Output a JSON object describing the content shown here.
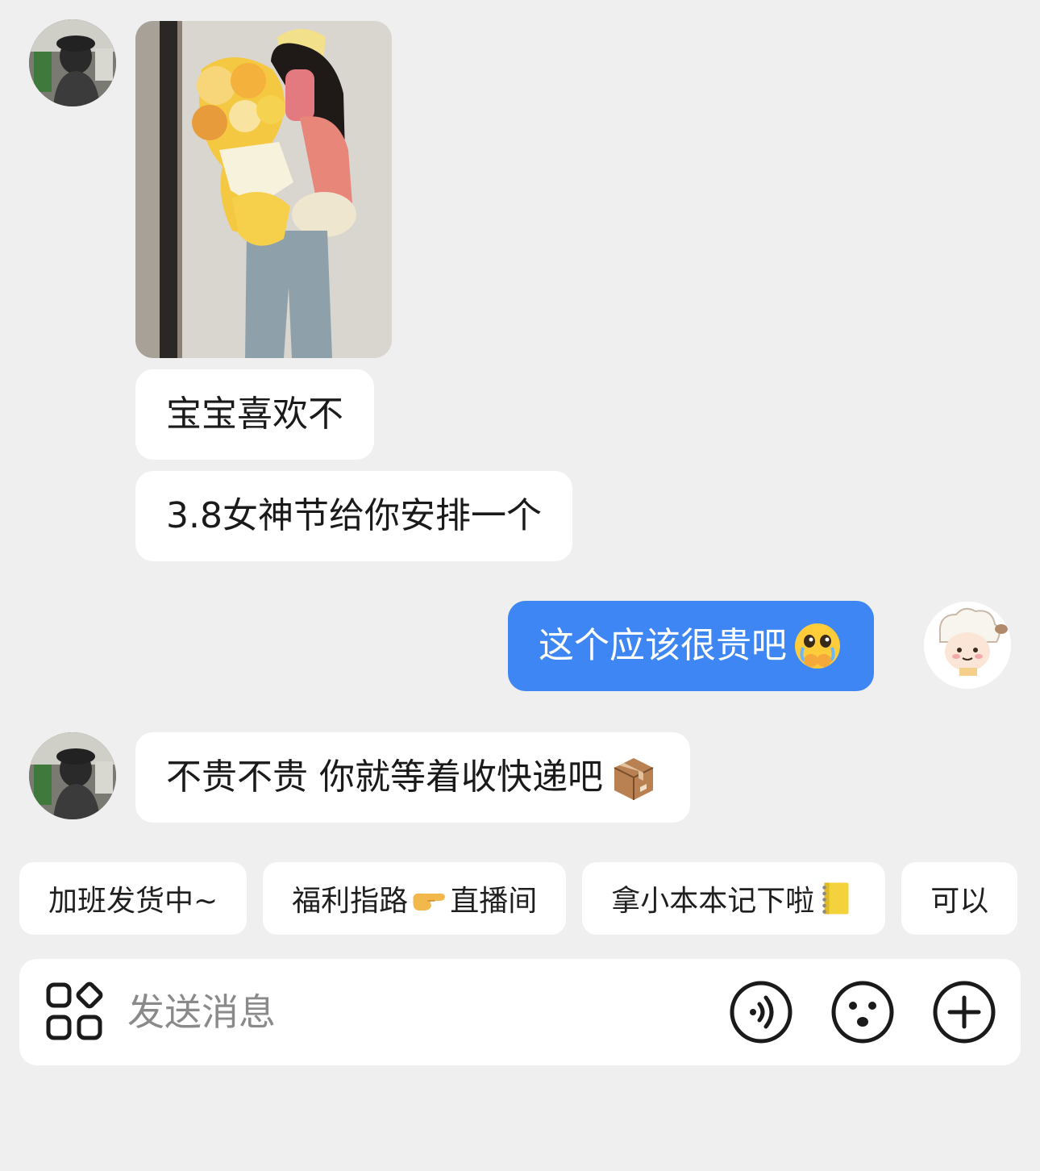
{
  "messages": [
    {
      "sender": "contact",
      "type": "image"
    },
    {
      "sender": "contact",
      "type": "text",
      "text": "宝宝喜欢不"
    },
    {
      "sender": "contact",
      "type": "text",
      "text": "3.8女神节给你安排一个"
    },
    {
      "sender": "me",
      "type": "text",
      "text": "这个应该很贵吧",
      "emoji": "crying-face-emoji"
    },
    {
      "sender": "contact",
      "type": "text",
      "text": "不贵不贵 你就等着收快递吧",
      "emoji": "package-emoji"
    }
  ],
  "quick_replies": [
    {
      "label": "加班发货中~"
    },
    {
      "label_before": "福利指路",
      "emoji": "pointing-right-emoji",
      "label_after": "直播间"
    },
    {
      "label": "拿小本本记下啦",
      "emoji": "notebook-emoji"
    },
    {
      "label": "可以"
    }
  ],
  "input": {
    "placeholder": "发送消息"
  },
  "icons": [
    "apps-icon",
    "voice-icon",
    "emoji-face-icon",
    "plus-icon"
  ],
  "colors": {
    "background": "#efefef",
    "outgoing_bubble": "#3f86f5",
    "incoming_bubble": "#ffffff"
  }
}
